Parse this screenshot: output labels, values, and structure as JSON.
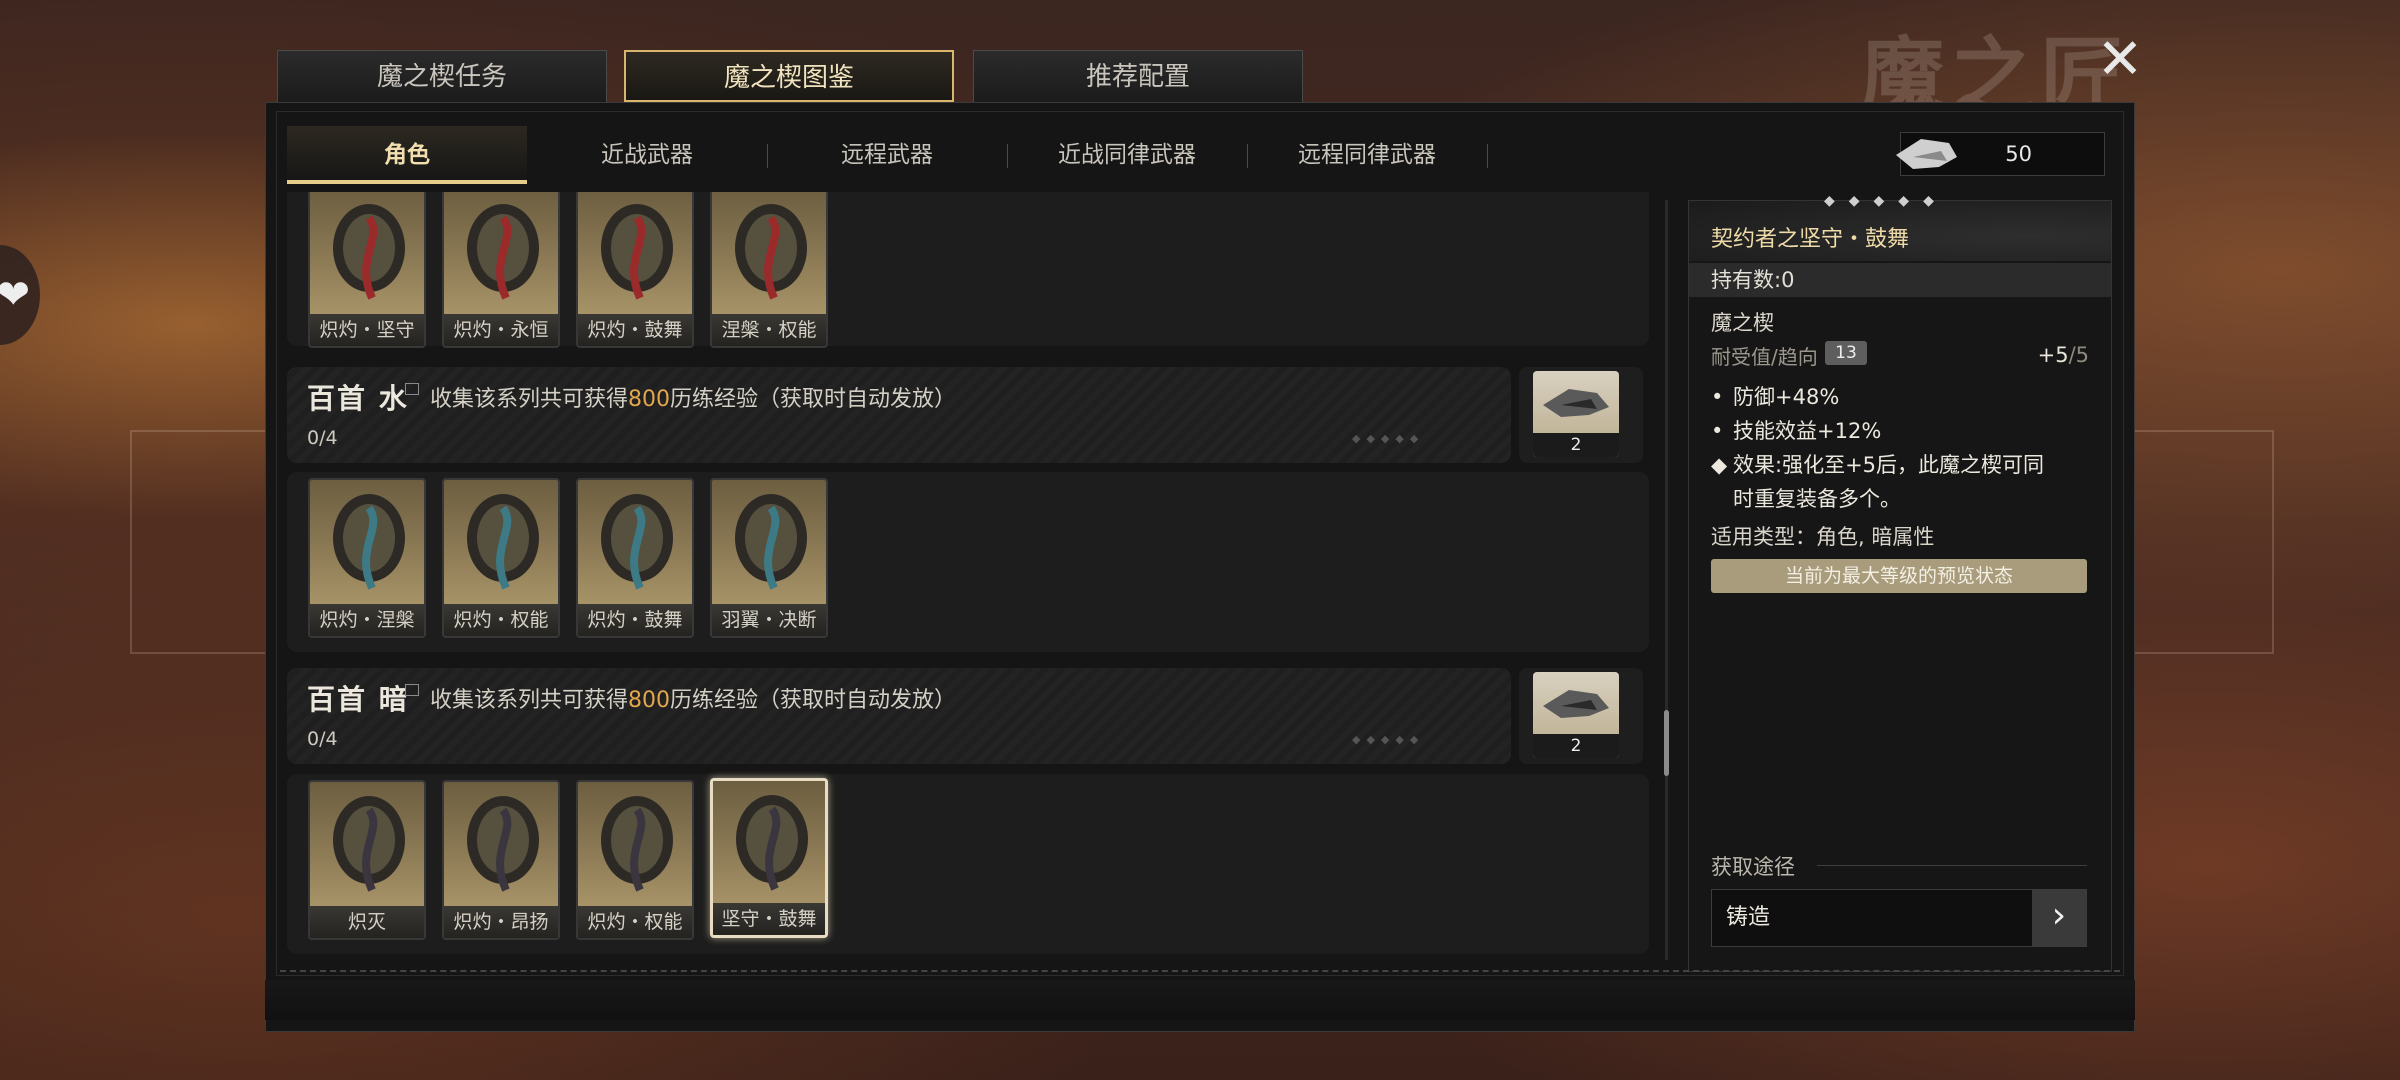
{
  "background": {
    "watermark": "魔之匠"
  },
  "top_tabs": [
    {
      "label": "魔之楔任务",
      "active": false
    },
    {
      "label": "魔之楔图鉴",
      "active": true
    },
    {
      "label": "推荐配置",
      "active": false
    }
  ],
  "sub_tabs": [
    {
      "label": "角色",
      "active": true
    },
    {
      "label": "近战武器",
      "active": false
    },
    {
      "label": "远程武器",
      "active": false
    },
    {
      "label": "近战同律武器",
      "active": false
    },
    {
      "label": "远程同律武器",
      "active": false
    }
  ],
  "currency": {
    "icon": "mod-currency-icon",
    "value": "50"
  },
  "groups": [
    {
      "items": [
        {
          "label": "炽灼・坚守",
          "accent": "#9b2a2a"
        },
        {
          "label": "炽灼・永恒",
          "accent": "#9b2a2a"
        },
        {
          "label": "炽灼・鼓舞",
          "accent": "#9b2a2a"
        },
        {
          "label": "涅槃・权能",
          "accent": "#9b2a2a"
        }
      ]
    },
    {
      "header": {
        "name": "百首 水",
        "desc_prefix": "收集该系列共可获得",
        "desc_highlight": "800",
        "desc_suffix": "历练经验（获取时自动发放）",
        "progress": "0/4",
        "reward_qty": "2"
      },
      "items": [
        {
          "label": "炽灼・涅槃",
          "accent": "#3d7a86"
        },
        {
          "label": "炽灼・权能",
          "accent": "#3d7a86"
        },
        {
          "label": "炽灼・鼓舞",
          "accent": "#3d7a86"
        },
        {
          "label": "羽翼・决断",
          "accent": "#3d7a86"
        }
      ]
    },
    {
      "header": {
        "name": "百首 暗",
        "desc_prefix": "收集该系列共可获得",
        "desc_highlight": "800",
        "desc_suffix": "历练经验（获取时自动发放）",
        "progress": "0/4",
        "reward_qty": "2"
      },
      "items": [
        {
          "label": "炽灭",
          "accent": "#3b3540"
        },
        {
          "label": "炽灼・昂扬",
          "accent": "#3b3540"
        },
        {
          "label": "炽灼・权能",
          "accent": "#3b3540"
        },
        {
          "label": "坚守・鼓舞",
          "accent": "#3b3540",
          "selected": true
        }
      ]
    }
  ],
  "detail": {
    "title": "契约者之坚守・鼓舞",
    "owned": "持有数:0",
    "type": "魔之楔",
    "tolerance_label": "耐受值/趋向",
    "tolerance_value": "13",
    "level_current": "+5",
    "level_max": "/5",
    "stats": [
      {
        "bullet": "•",
        "text": "防御+48%"
      },
      {
        "bullet": "•",
        "text": "技能效益+12%"
      },
      {
        "bullet": "◆",
        "text": "效果:强化至+5后，此魔之楔可同"
      },
      {
        "bullet": "",
        "text": "时重复装备多个。"
      }
    ],
    "apply": "适用类型：角色, 暗属性",
    "preview_note": "当前为最大等级的预览状态",
    "acquire_label": "获取途径",
    "acquire_method": "铸造"
  }
}
